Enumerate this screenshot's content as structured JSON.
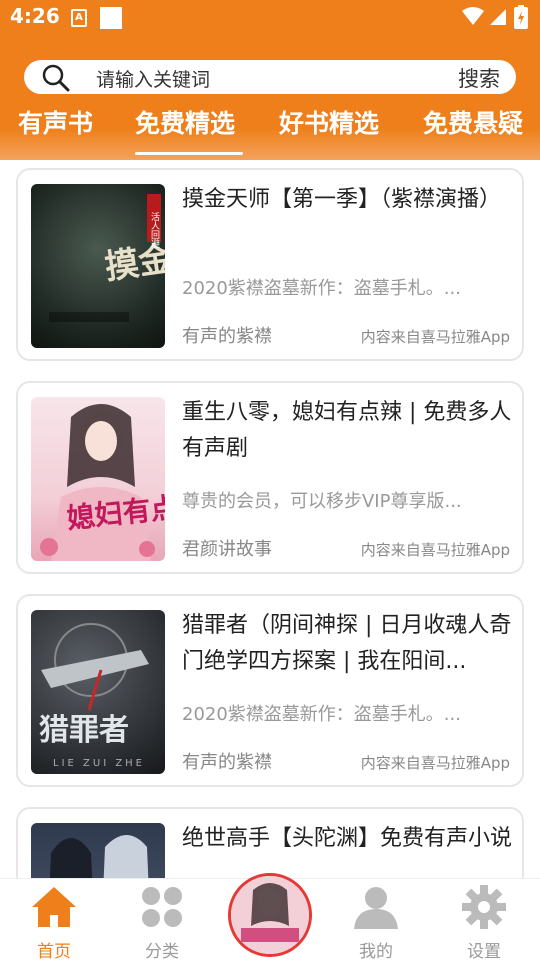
{
  "status_bar": {
    "time": "4:26",
    "notif_icon": "A"
  },
  "search": {
    "placeholder": "请输入关键词",
    "button_label": "搜索"
  },
  "tabs": [
    {
      "label": "有声书",
      "active": false
    },
    {
      "label": "免费精选",
      "active": true
    },
    {
      "label": "好书精选",
      "active": false
    },
    {
      "label": "免费悬疑",
      "active": false
    }
  ],
  "books": [
    {
      "title": "摸金天师【第一季】（紫襟演播）",
      "desc": "2020紫襟盗墓新作：盗墓手札。...",
      "author": "有声的紫襟",
      "source": "内容来自喜马拉雅App",
      "cover_text": "摸金天师",
      "cover_tag": "活人回避"
    },
    {
      "title": "重生八零，媳妇有点辣 | 免费多人有声剧",
      "desc": "尊贵的会员，可以移步VIP尊享版...",
      "author": "君颜讲故事",
      "source": "内容来自喜马拉雅App",
      "cover_text": "媳妇有点辣"
    },
    {
      "title": "猎罪者（阴间神探 | 日月收魂人奇门绝学四方探案 | 我在阳间...",
      "desc": "2020紫襟盗墓新作：盗墓手札。...",
      "author": "有声的紫襟",
      "source": "内容来自喜马拉雅App",
      "cover_text": "猎罪者",
      "cover_sub": "LIE ZUI ZHE"
    },
    {
      "title": "绝世高手【头陀渊】免费有声小说"
    }
  ],
  "bottom_nav": [
    {
      "label": "首页",
      "icon": "home-icon",
      "active": true
    },
    {
      "label": "分类",
      "icon": "category-icon",
      "active": false
    },
    {
      "label": "我的",
      "icon": "user-icon",
      "active": false
    },
    {
      "label": "设置",
      "icon": "gear-icon",
      "active": false
    }
  ],
  "colors": {
    "accent": "#ee7f1a",
    "inactive": "#bbbbbb"
  }
}
